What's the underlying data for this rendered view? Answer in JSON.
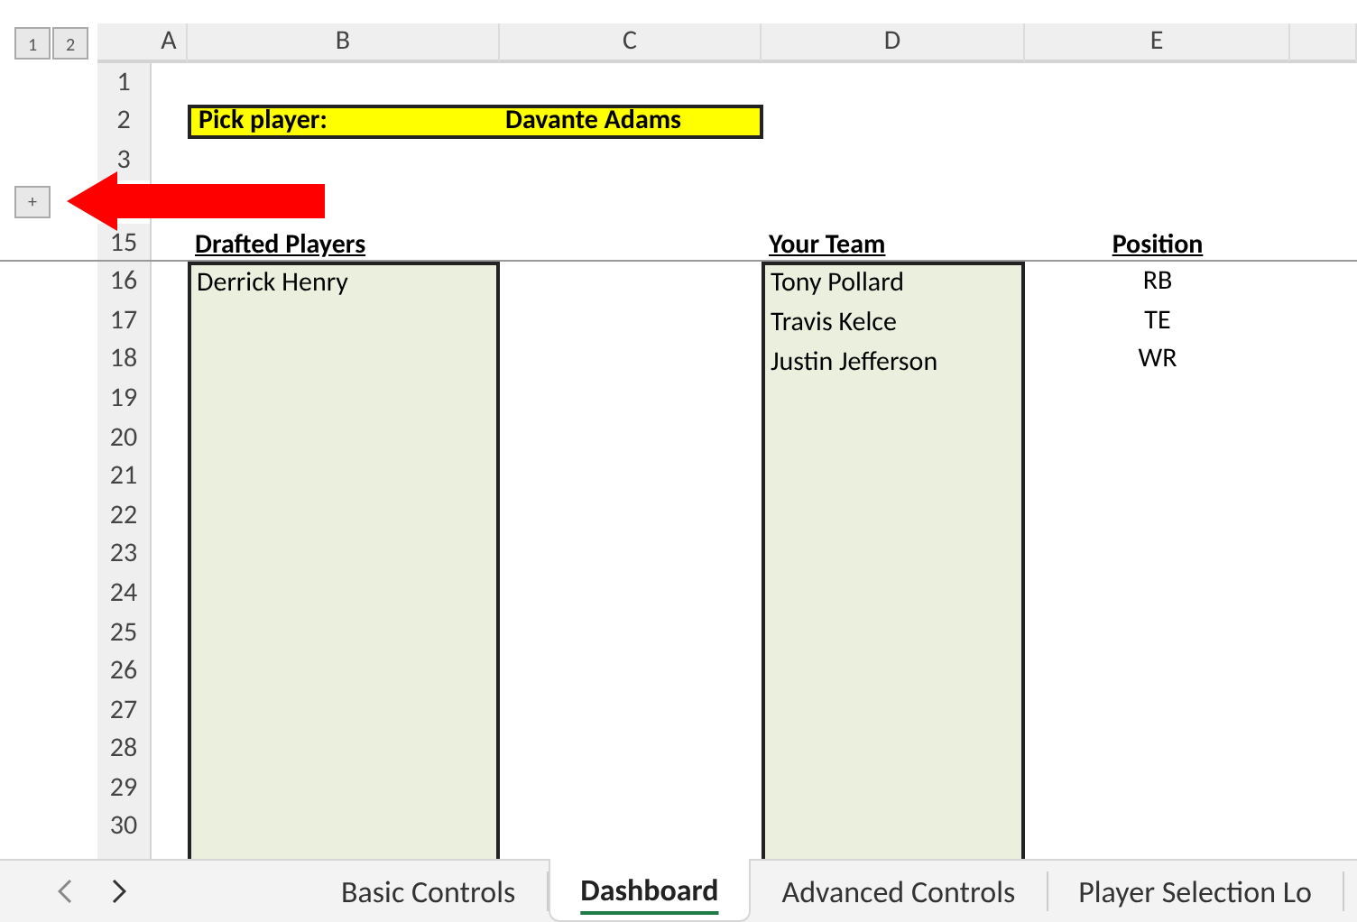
{
  "outline": {
    "levels": [
      "1",
      "2"
    ],
    "expand": "+"
  },
  "column_headers": [
    "A",
    "B",
    "C",
    "D",
    "E"
  ],
  "row_numbers": [
    "1",
    "2",
    "3",
    "15",
    "16",
    "17",
    "18",
    "19",
    "20",
    "21",
    "22",
    "23",
    "24",
    "25",
    "26",
    "27",
    "28",
    "29",
    "30"
  ],
  "pick_player": {
    "label": "Pick player:",
    "value": "Davante Adams"
  },
  "drafted": {
    "header": "Drafted Players",
    "players": [
      "Derrick Henry"
    ]
  },
  "team": {
    "header": "Your Team",
    "position_header": "Position",
    "players": [
      {
        "name": "Tony Pollard",
        "position": "RB"
      },
      {
        "name": "Travis Kelce",
        "position": "TE"
      },
      {
        "name": "Justin Jefferson",
        "position": "WR"
      }
    ]
  },
  "sheet_tabs": [
    {
      "label": "Basic Controls",
      "selected": false
    },
    {
      "label": "Dashboard",
      "selected": true
    },
    {
      "label": "Advanced Controls",
      "selected": false
    },
    {
      "label": "Player Selection Lo",
      "selected": false
    }
  ]
}
